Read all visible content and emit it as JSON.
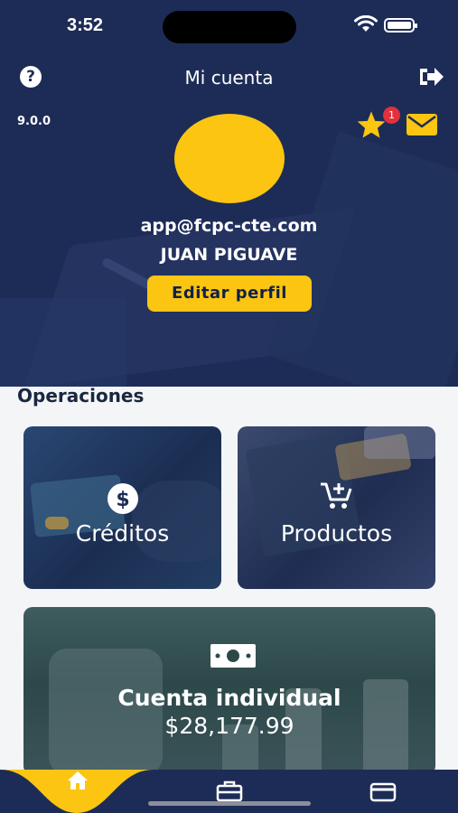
{
  "status_bar": {
    "time": "3:52"
  },
  "header": {
    "title": "Mi cuenta",
    "help_icon": "question-circle-icon",
    "logout_icon": "logout-icon",
    "version": "9.0.0",
    "favorites_icon": "star-icon",
    "notification_count": "1",
    "messages_icon": "mail-icon"
  },
  "profile": {
    "email": "app@fcpc-cte.com",
    "name": "JUAN PIGUAVE",
    "edit_label": "Editar perfil",
    "avatar_color": "#fbc511"
  },
  "operations": {
    "title": "Operaciones",
    "cards": [
      {
        "label": "Créditos",
        "icon": "dollar-circle-icon"
      },
      {
        "label": "Productos",
        "icon": "cart-plus-icon"
      }
    ],
    "account": {
      "label": "Cuenta individual",
      "amount": "$28,177.99",
      "icon": "money-bill-icon"
    }
  },
  "tabbar": {
    "tabs": [
      {
        "icon": "home-icon",
        "active": true
      },
      {
        "icon": "briefcase-icon",
        "active": false
      },
      {
        "icon": "credit-card-icon",
        "active": false
      }
    ]
  },
  "colors": {
    "primary": "#1d2c57",
    "accent": "#fbc511",
    "badge": "#e0313c"
  }
}
